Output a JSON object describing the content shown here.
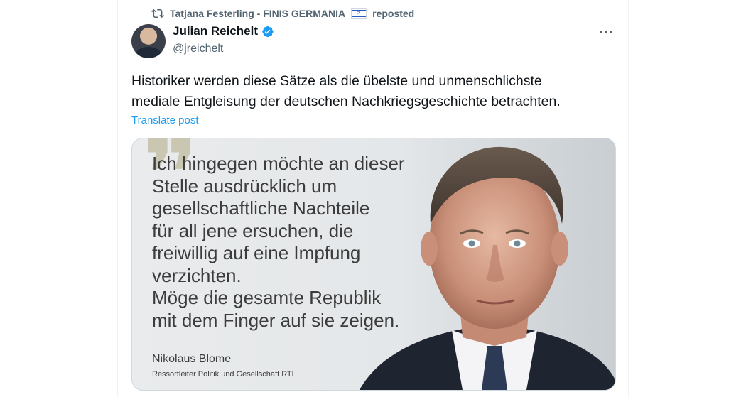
{
  "repost": {
    "reposter_name": "Tatjana Festerling - FINIS GERMANIA",
    "reposted_label": "reposted",
    "flag": "israel-flag-emoji"
  },
  "author": {
    "display_name": "Julian Reichelt",
    "handle": "@jreichelt",
    "verified": true,
    "verified_color": "#1d9bf0"
  },
  "post": {
    "text_line1": "Historiker werden diese Sätze als die übelste und unmenschlichste",
    "text_line2": "mediale Entgleisung der deutschen Nachkriegsgeschichte betrachten.",
    "translate_label": "Translate post"
  },
  "media": {
    "quote_lines": [
      "Ich hingegen möchte an dieser",
      "Stelle ausdrücklich um",
      "gesellschaftliche Nachteile",
      "für all jene ersuchen, die",
      "freiwillig auf eine Impfung",
      "verzichten.",
      "Möge die gesamte Republik",
      "mit dem Finger auf sie zeigen."
    ],
    "quote_author": "Nikolaus Blome",
    "quote_author_role": "Ressortleiter Politik und Gesellschaft RTL"
  },
  "icons": {
    "repost": "repost-icon",
    "verified": "verified-badge-icon",
    "more": "more-horizontal-icon"
  },
  "colors": {
    "link": "#1d9bf0",
    "secondary_text": "#536471",
    "primary_text": "#0f1419"
  }
}
